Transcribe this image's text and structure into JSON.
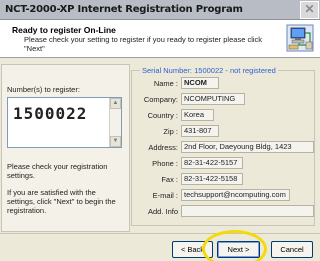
{
  "window": {
    "title": "NCT-2000-XP Internet Registration Program",
    "close_glyph": "✕"
  },
  "header": {
    "title": "Ready to register On-Line",
    "description": "Please check your setting to register  if you ready to register please click \"Next\""
  },
  "left_panel": {
    "numbers_label": "Number(s) to register:",
    "number_value": "1500022",
    "check_text": "Please check your registration settings.",
    "satisfied_text": "If you are satisfied with the settings, click \"Next\" to begin the registration."
  },
  "serial": {
    "legend": "Serial Number: 1500022  - not registered",
    "fields": [
      {
        "label": "Name :",
        "value": "NCOM"
      },
      {
        "label": "Company:",
        "value": "NCOMPUTING"
      },
      {
        "label": "Country :",
        "value": "Korea"
      },
      {
        "label": "Zip :",
        "value": "431-807"
      },
      {
        "label": "Address:",
        "value": "2nd Floor, Daeyoung Bldg, 1423"
      },
      {
        "label": "Phone :",
        "value": "82-31-422-5157"
      },
      {
        "label": "Fax :",
        "value": "82-31-422-5158"
      },
      {
        "label": "E-mail :",
        "value": "techsupport@ncomputing.com"
      },
      {
        "label": "Add. Info",
        "value": ""
      }
    ]
  },
  "buttons": {
    "back": "< Back",
    "next": "Next >",
    "cancel": "Cancel"
  },
  "colors": {
    "legend_blue": "#3060d0",
    "highlight_yellow": "#f5d90a"
  },
  "icons": {
    "header_icon": "computer-network-icon",
    "close_icon": "close-icon"
  }
}
